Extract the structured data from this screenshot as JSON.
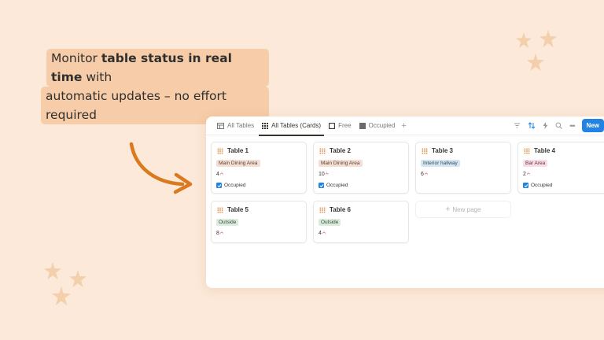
{
  "headline": {
    "line1_pre": "Monitor ",
    "line1_bold": "table status in real time",
    "line1_post": " with",
    "line2": "automatic updates – no effort required"
  },
  "colors": {
    "background": "#fce9d9",
    "highlight": "#f6cda8",
    "arrow": "#d97a1f",
    "star": "#f4cfac",
    "accent_blue": "#2383e2"
  },
  "tabs": [
    {
      "label": "All Tables",
      "icon": "table-icon"
    },
    {
      "label": "All Tables (Cards)",
      "icon": "grid-icon",
      "active": true
    },
    {
      "label": "Free",
      "icon": "checkbox-empty-icon"
    },
    {
      "label": "Occupied",
      "icon": "checkbox-filled-icon"
    }
  ],
  "toolbar": {
    "new_label": "New"
  },
  "cards": [
    {
      "title": "Table 1",
      "area": "Main Dining Area",
      "seats": "4",
      "status": "Occupied"
    },
    {
      "title": "Table 2",
      "area": "Main Dining Area",
      "seats": "10",
      "status": "Occupied"
    },
    {
      "title": "Table 3",
      "area": "Interior hallway",
      "seats": "6",
      "status": ""
    },
    {
      "title": "Table 4",
      "area": "Bar Area",
      "seats": "2",
      "status": "Occupied"
    },
    {
      "title": "Table 5",
      "area": "Outside",
      "seats": "8",
      "status": ""
    },
    {
      "title": "Table 6",
      "area": "Outside",
      "seats": "4",
      "status": ""
    }
  ],
  "new_page_label": "New page"
}
